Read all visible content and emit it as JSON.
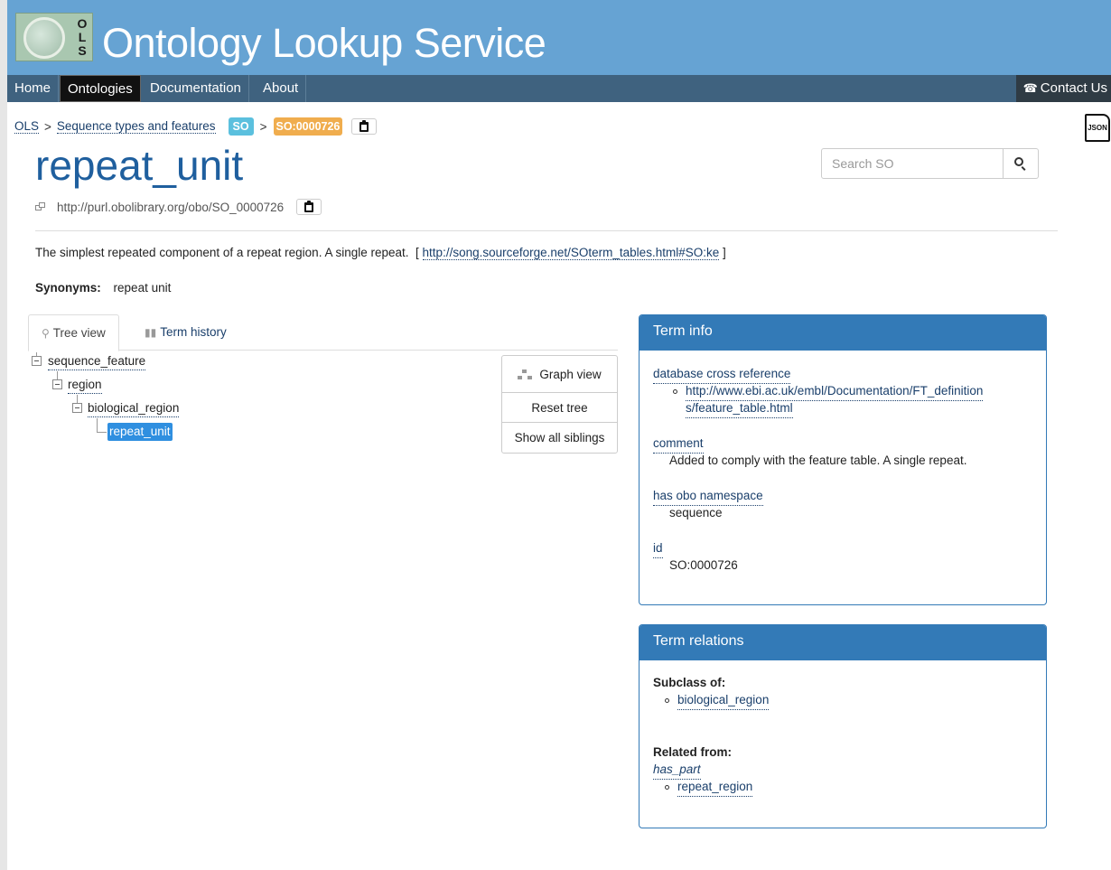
{
  "header": {
    "logo_letters": [
      "O",
      "L",
      "S"
    ],
    "site_title": "Ontology Lookup Service"
  },
  "nav": {
    "items": [
      "Home",
      "Ontologies",
      "Documentation",
      "About"
    ],
    "active": "Ontologies",
    "contact": "Contact Us"
  },
  "breadcrumb": {
    "root": "OLS",
    "separator": ">",
    "ontology_name": "Sequence types and features",
    "ontology_badge": "SO",
    "term_id": "SO:0000726"
  },
  "json_icon_label": "JSON",
  "term": {
    "label": "repeat_unit",
    "iri": "http://purl.obolibrary.org/obo/SO_0000726",
    "description": "The simplest repeated component of a repeat region. A single repeat.",
    "description_ref": "http://song.sourceforge.net/SOterm_tables.html#SO:ke",
    "synonyms_label": "Synonyms:",
    "synonym": "repeat unit"
  },
  "search": {
    "placeholder": "Search SO"
  },
  "tabs": [
    "Tree view",
    "Term history"
  ],
  "tree": {
    "nodes": [
      "sequence_feature",
      "region",
      "biological_region",
      "repeat_unit"
    ],
    "selected": "repeat_unit"
  },
  "tree_buttons": [
    "Graph view",
    "Reset tree",
    "Show all siblings"
  ],
  "term_info": {
    "title": "Term info",
    "xref_label": "database cross reference",
    "xref_line1": "http://www.ebi.ac.uk/embl/Documentation/FT_definition",
    "xref_line2": "s/feature_table.html",
    "comment_label": "comment",
    "comment_value": "Added to comply with the feature table. A single repeat.",
    "namespace_label": "has obo namespace",
    "namespace_value": "sequence",
    "id_label": "id",
    "id_value": "SO:0000726"
  },
  "term_relations": {
    "title": "Term relations",
    "subclass_label": "Subclass of:",
    "subclass_value": "biological_region",
    "related_label": "Related from:",
    "relation": "has_part",
    "related_value": "repeat_region"
  },
  "colors": {
    "header_bg": "#66a3d3",
    "navbar_bg": "#3f627f",
    "title": "#1f5f9e",
    "panel_head": "#337ab7",
    "badge_so": "#5bc0de",
    "badge_id": "#f0ad4e",
    "selected_node": "#2f8fe0"
  }
}
